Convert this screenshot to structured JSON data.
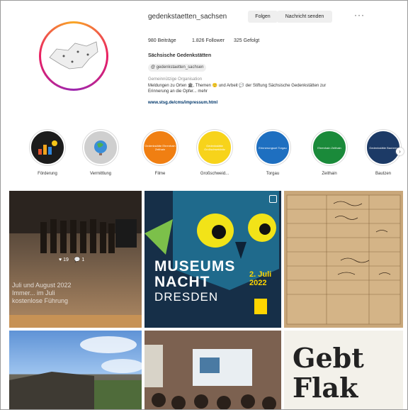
{
  "profile": {
    "username": "gedenkstaetten_sachsen",
    "follow_label": "Folgen",
    "message_label": "Nachricht senden",
    "more_label": "···",
    "stats": {
      "posts": "980 Beiträge",
      "followers": "1.826 Follower",
      "following": "325 Gefolgt"
    },
    "full_name": "Sächsische Gedenkstätten",
    "handle_chip": "@ gedenkstaetten_sachsen",
    "category": "Gemeinnützige Organisation",
    "bio": "Meldungen zu Orten 🏛, Themen 🙂 und Arbeit 💬 der Stiftung Sächsische Gedenkstätten zur Erinnerung an die Opfer... mehr",
    "link": "www.stsg.de/cms/impressum.html"
  },
  "highlights": [
    {
      "label": "Förderung",
      "color": "#1c1c1c"
    },
    {
      "label": "Vermittlung",
      "color": "#cfcfcf"
    },
    {
      "label": "Filme",
      "color": "#f07f12",
      "text": "Gedenkstätte Ehrenhain Zeithain"
    },
    {
      "label": "Großschweid...",
      "color": "#f7d31b",
      "text": "Gedenkstätte Großschweidnitz"
    },
    {
      "label": "Torgau",
      "color": "#1e6fc0",
      "text": "Erinnerungsort Torgau"
    },
    {
      "label": "Zeithain",
      "color": "#1a8a3a",
      "text": "Ehrenhain Zeithain"
    },
    {
      "label": "Bautzen",
      "color": "#1c3a66",
      "text": "Gedenkstätte Bautzen"
    }
  ],
  "posts": {
    "p1_overlay": "Juli und August 2022\nImmer... im Juli\nkostenlose Führung",
    "p1_likes": "♥ 19",
    "p1_comments": "💬 1",
    "p2_title": "MUSEUMS\nNACHT",
    "p2_sub": "DRESDEN",
    "p2_date": "2. Juli\n2022",
    "p6_text": "Gebt\nFlak"
  },
  "icons": {
    "multi": "multi-post-icon",
    "arrow": "chevron-right-icon"
  }
}
